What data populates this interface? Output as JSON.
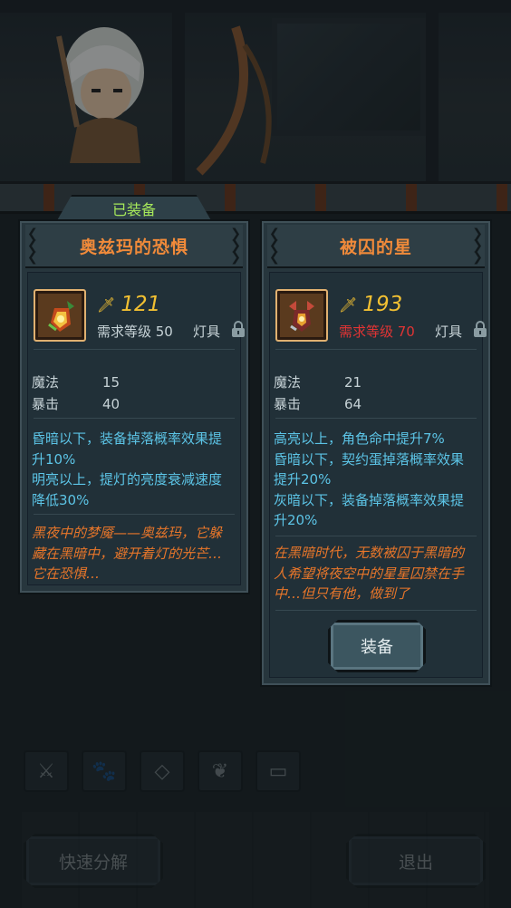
{
  "equipped_tab": "已装备",
  "left_item": {
    "name": "奥兹玛的恐惧",
    "power": "121",
    "requirement": "需求等级 50",
    "slot": "灯具",
    "stats": [
      {
        "label": "魔法",
        "value": "15"
      },
      {
        "label": "暴击",
        "value": "40"
      }
    ],
    "effects": [
      "昏暗以下，装备掉落概率效果提升10%",
      "明亮以上，提灯的亮度衰减速度降低30%"
    ],
    "lore": "黑夜中的梦魇——奥兹玛，它躲藏在黑暗中，避开着灯的光芒…它在恐惧…"
  },
  "right_item": {
    "name": "被囚的星",
    "power": "193",
    "requirement": "需求等级 70",
    "slot": "灯具",
    "stats": [
      {
        "label": "魔法",
        "value": "21"
      },
      {
        "label": "暴击",
        "value": "64"
      }
    ],
    "effects": [
      "高亮以上，角色命中提升7%",
      "昏暗以下，契约蛋掉落概率效果提升20%",
      "灰暗以下，装备掉落概率效果提升20%"
    ],
    "lore": "在黑暗时代，无数被囚于黑暗的人希望将夜空中的星星囚禁在手中…但只有他，做到了",
    "equip_label": "装备"
  },
  "bottom": {
    "decompose_label": "快速分解",
    "exit_label": "退出"
  },
  "colors": {
    "title_orange": "#f08a3a",
    "power_gold": "#f2c032",
    "effect_cyan": "#5cc4e6",
    "lore_orange": "#e8762a",
    "requirement_red": "#e03434",
    "equipped_green": "#a6e85a"
  },
  "icons": [
    "sword-power-icon",
    "lock-icon",
    "lantern-icon",
    "star-lantern-icon",
    "weapon-filter-icon",
    "pet-filter-icon",
    "gem-filter-icon",
    "leaf-filter-icon",
    "chest-filter-icon"
  ]
}
